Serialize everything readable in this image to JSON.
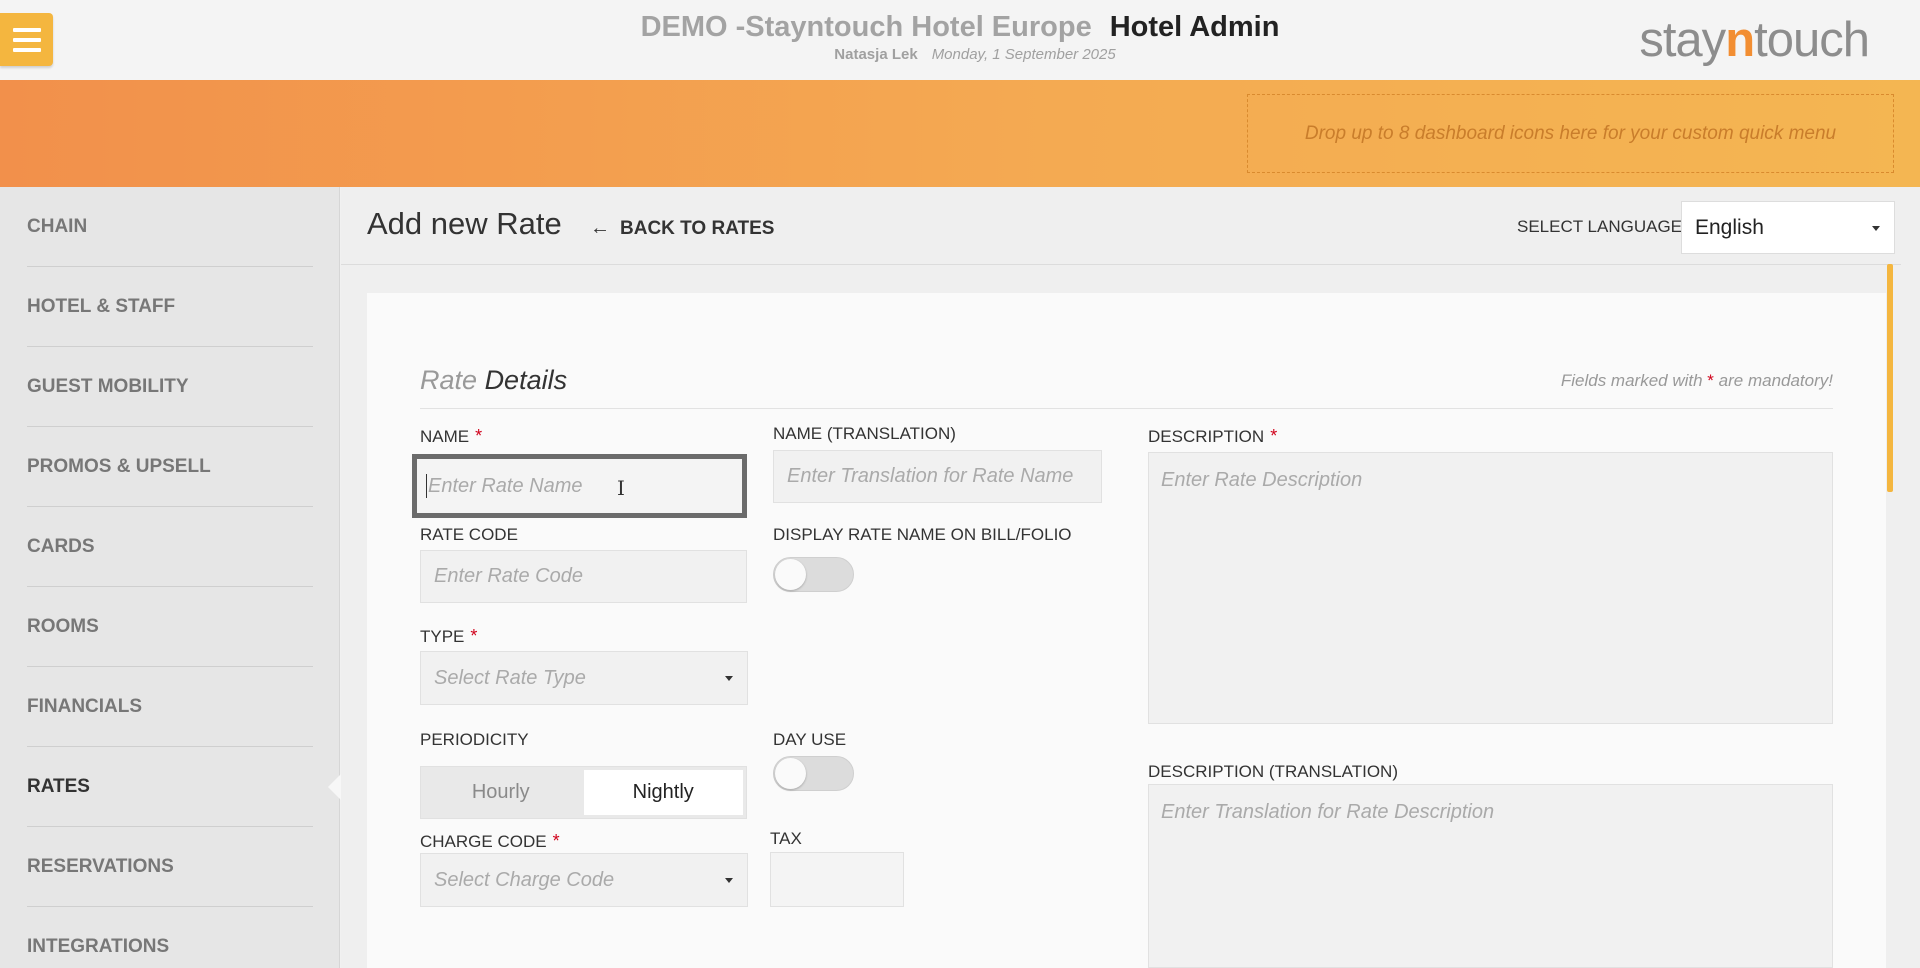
{
  "header": {
    "hotel_name": "DEMO -Stayntouch Hotel Europe",
    "app_name": "Hotel Admin",
    "user": "Natasja Lek",
    "date": "Monday, 1 September 2025",
    "logo_prefix": "stay",
    "logo_n": "n",
    "logo_suffix": "touch"
  },
  "banner": {
    "dropzone_text": "Drop up to 8 dashboard icons here for your custom quick menu"
  },
  "sidebar": {
    "items": [
      {
        "label": "CHAIN"
      },
      {
        "label": "HOTEL & STAFF"
      },
      {
        "label": "GUEST MOBILITY"
      },
      {
        "label": "PROMOS & UPSELL"
      },
      {
        "label": "CARDS"
      },
      {
        "label": "ROOMS"
      },
      {
        "label": "FINANCIALS"
      },
      {
        "label": "RATES"
      },
      {
        "label": "RESERVATIONS"
      },
      {
        "label": "INTEGRATIONS"
      }
    ],
    "active": "RATES"
  },
  "page": {
    "title": "Add new Rate",
    "back_label": "BACK TO RATES",
    "back_icon": "left-arrow-icon",
    "language_label": "SELECT LANGUAGE",
    "language_value": "English"
  },
  "form": {
    "section_title_light": "Rate",
    "section_title_dark": "Details",
    "mandatory_prefix": "Fields marked with",
    "mandatory_star": "*",
    "mandatory_suffix": "are mandatory!",
    "required_mark": "*",
    "name_label": "NAME",
    "name_placeholder": "Enter Rate Name",
    "name_translation_label": "NAME (TRANSLATION)",
    "name_translation_placeholder": "Enter Translation for Rate Name",
    "rate_code_label": "RATE CODE",
    "rate_code_placeholder": "Enter Rate Code",
    "display_name_label": "DISPLAY RATE NAME ON BILL/FOLIO",
    "display_name_on": false,
    "type_label": "TYPE",
    "type_placeholder": "Select Rate Type",
    "periodicity_label": "PERIODICITY",
    "periodicity_options": [
      "Hourly",
      "Nightly"
    ],
    "periodicity_selected": "Nightly",
    "day_use_label": "DAY USE",
    "day_use_on": false,
    "charge_code_label": "CHARGE CODE",
    "charge_code_placeholder": "Select Charge Code",
    "tax_label": "TAX",
    "tax_value": "",
    "description_label": "DESCRIPTION",
    "description_placeholder": "Enter Rate Description",
    "description_translation_label": "DESCRIPTION (TRANSLATION)",
    "description_translation_placeholder": "Enter Translation for Rate Description"
  },
  "colors": {
    "accent": "#f4b63f",
    "banner_start": "#f2904b",
    "banner_end": "#f4b652",
    "required": "#d0021b"
  }
}
